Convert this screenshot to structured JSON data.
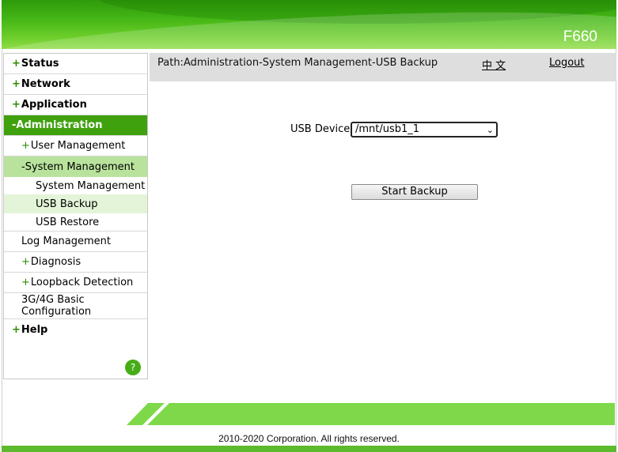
{
  "header": {
    "model": "F660"
  },
  "sidebar": {
    "items": [
      {
        "label": "Status",
        "prefix": "+"
      },
      {
        "label": "Network",
        "prefix": "+"
      },
      {
        "label": "Application",
        "prefix": "+"
      },
      {
        "label": "Administration",
        "prefix": "-"
      },
      {
        "label": "User Management",
        "prefix": "+"
      },
      {
        "label": "System Management",
        "prefix": "-"
      },
      {
        "label": "System Management"
      },
      {
        "label": "USB Backup"
      },
      {
        "label": "USB Restore"
      },
      {
        "label": "Log Management"
      },
      {
        "label": "Diagnosis",
        "prefix": "+"
      },
      {
        "label": "Loopback Detection",
        "prefix": "+"
      },
      {
        "label": "3G/4G Basic",
        "label2": "Configuration"
      },
      {
        "label": "Help",
        "prefix": "+"
      }
    ],
    "help_icon": "?"
  },
  "topbar": {
    "path": "Path:Administration-System Management-USB Backup",
    "language": "中 文",
    "logout": "Logout"
  },
  "form": {
    "usb_device_label": "USB Device",
    "usb_device_value": "/mnt/usb1_1",
    "start_backup": "Start Backup"
  },
  "footer": {
    "copyright": "2010-2020 Corporation. All rights reserved."
  },
  "colors": {
    "brand_green": "#3fa10e",
    "submenu_active": "#b9e39d",
    "leaf_active": "#e4f4d8"
  }
}
